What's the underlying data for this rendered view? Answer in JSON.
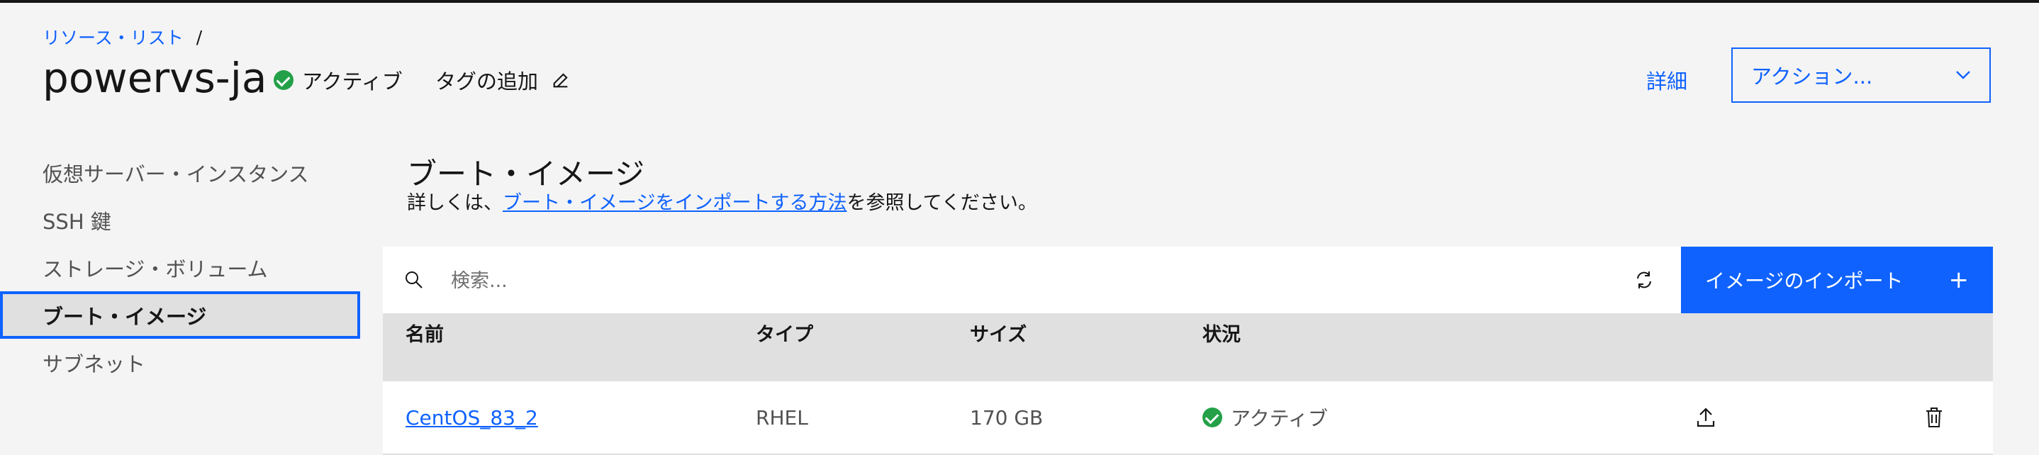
{
  "breadcrumb": {
    "link": "リソース・リスト",
    "separator": "/"
  },
  "title": "powervs-ja",
  "status": {
    "label": "アクティブ"
  },
  "tags": {
    "label": "タグの追加"
  },
  "header": {
    "details": "詳細",
    "actions": "アクション..."
  },
  "sidebar": {
    "items": [
      {
        "label": "仮想サーバー・インスタンス"
      },
      {
        "label": "SSH 鍵"
      },
      {
        "label": "ストレージ・ボリューム"
      },
      {
        "label": "ブート・イメージ"
      },
      {
        "label": "サブネット"
      }
    ]
  },
  "main": {
    "heading": "ブート・イメージ",
    "desc_prefix": "詳しくは、",
    "desc_link": "ブート・イメージをインポートする方法",
    "desc_suffix": "を参照してください。",
    "search_placeholder": "検索...",
    "import_label": "イメージのインポート",
    "import_plus": "+"
  },
  "table": {
    "headers": [
      "名前",
      "タイプ",
      "サイズ",
      "状況"
    ],
    "rows": [
      {
        "name": "CentOS_83_2",
        "type": "RHEL",
        "size": "170 GB",
        "status": "アクティブ"
      }
    ]
  },
  "colors": {
    "accent": "#0f62fe",
    "success": "#24a148",
    "background": "#f4f4f4"
  }
}
